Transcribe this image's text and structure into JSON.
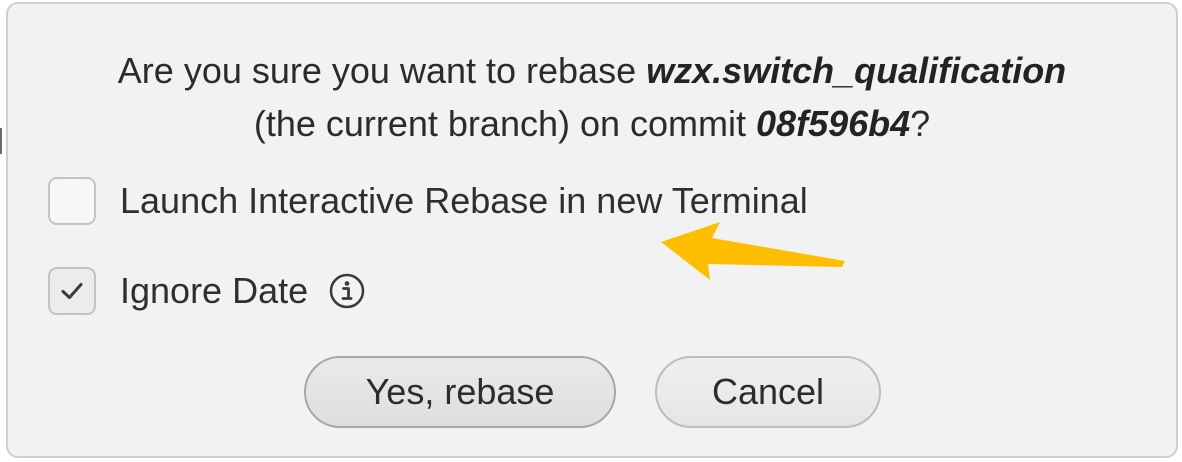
{
  "dialog": {
    "message": {
      "prefix": "Are you sure you want to rebase ",
      "branch": "wzx.switch_qualification",
      "middle": "(the current branch) on commit ",
      "commit": "08f596b4",
      "suffix": "?"
    },
    "options": [
      {
        "label": "Launch Interactive Rebase in new Terminal",
        "checked": false
      },
      {
        "label": "Ignore Date",
        "checked": true,
        "icon": "info-icon"
      }
    ],
    "buttons": {
      "confirm_label": "Yes, rebase",
      "cancel_label": "Cancel"
    },
    "annotation": {
      "icon": "arrow-pointer-icon",
      "color": "#ffbf00"
    }
  }
}
